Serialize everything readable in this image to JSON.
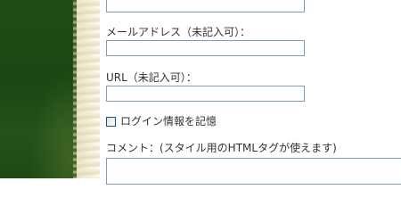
{
  "form": {
    "email_label": "メールアドレス（未記入可）：",
    "email_value": "",
    "url_label": "URL（未記入可）：",
    "url_value": "",
    "remember_label": "ログイン情報を記憶",
    "remember_checked": false,
    "comment_label": "コメント：(スタイル用のHTMLタグが使えます)",
    "comment_value": ""
  },
  "colors": {
    "sidebar_green": "#1f4d15",
    "input_border": "#7f9db9"
  }
}
